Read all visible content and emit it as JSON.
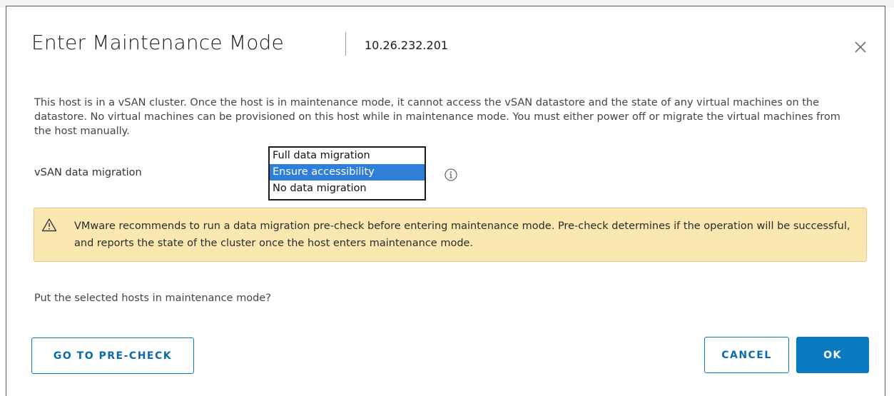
{
  "dialog": {
    "title": "Enter Maintenance Mode",
    "subtitle": "10.26.232.201",
    "close_icon": "close-icon",
    "description": "This host is in a vSAN cluster. Once the host is in maintenance mode, it cannot access the vSAN datastore and the state of any virtual machines on the datastore. No virtual machines can be provisioned on this host while in maintenance mode. You must either power off or migrate the virtual machines from the host manually.",
    "migration": {
      "label": "vSAN data migration",
      "options": [
        "Full data migration",
        "Ensure accessibility",
        "No data migration"
      ],
      "selected": "Ensure accessibility",
      "info_icon": "info-icon"
    },
    "alert": {
      "icon": "warning-icon",
      "text": "VMware recommends to run a data migration pre-check before entering maintenance mode. Pre-check determines if the operation will be successful, and reports the state of the cluster once the host enters maintenance mode."
    },
    "question": "Put the selected hosts in maintenance mode?",
    "buttons": {
      "precheck": "GO TO PRE-CHECK",
      "cancel": "CANCEL",
      "ok": "OK"
    }
  },
  "colors": {
    "accent": "#0a7bc1",
    "selection": "#2f7ed8",
    "alert_bg": "#fbe8b0",
    "alert_border": "#e8c878"
  }
}
